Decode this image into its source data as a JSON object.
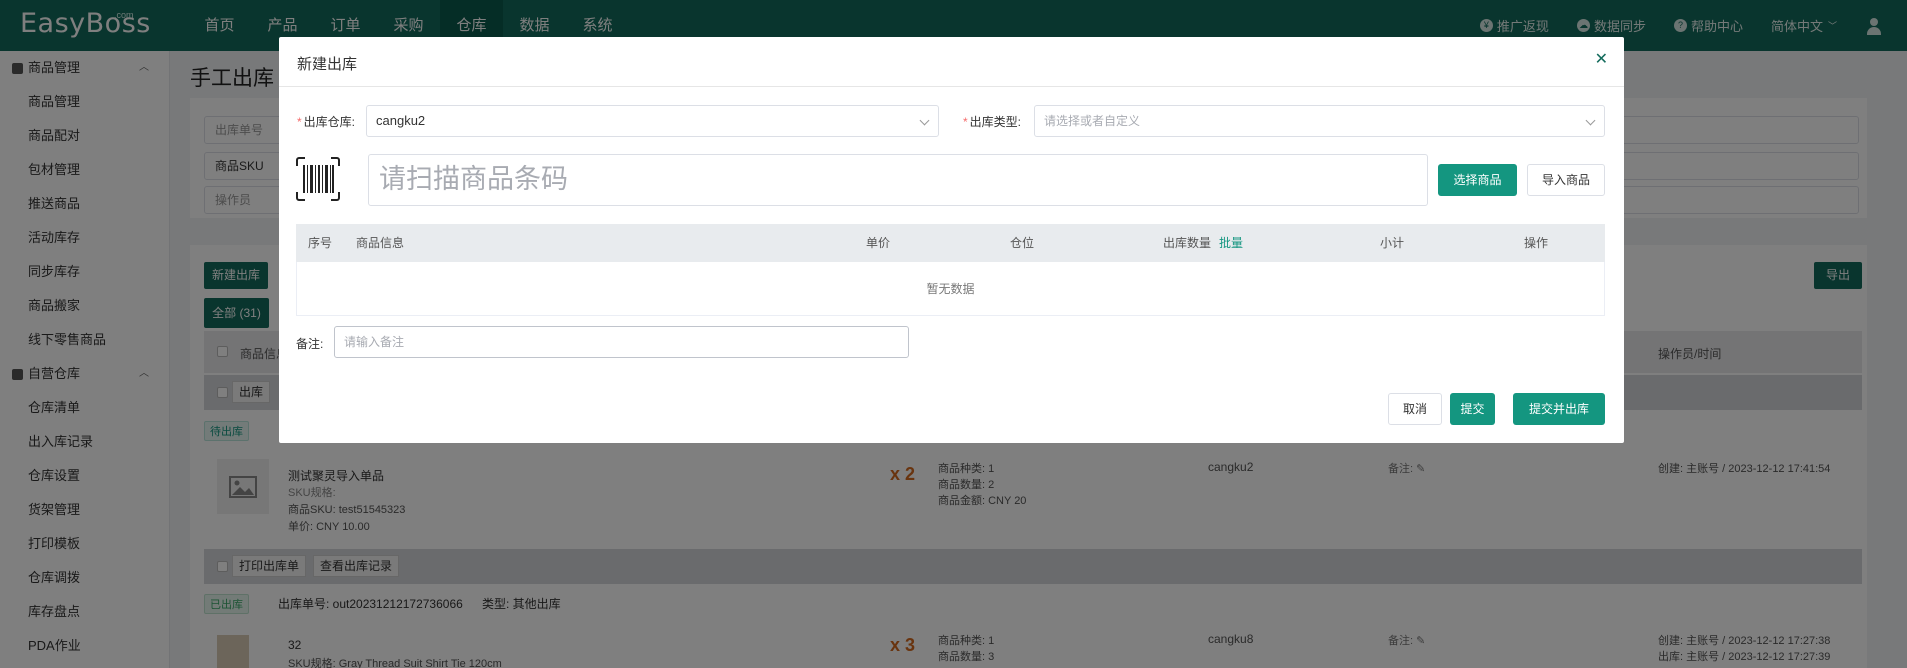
{
  "app": {
    "logo": "EasyBoss",
    "logo_suffix": ".com"
  },
  "nav": [
    "首页",
    "产品",
    "订单",
    "采购",
    "仓库",
    "数据",
    "系统"
  ],
  "top_right": {
    "promo": "推广返现",
    "sync": "数据同步",
    "help": "帮助中心",
    "lang": "简体中文"
  },
  "sidebar": {
    "group1": "商品管理",
    "group1_items": [
      "商品管理",
      "商品配对",
      "包材管理",
      "推送商品",
      "活动库存",
      "同步库存",
      "商品搬家",
      "线下零售商品"
    ],
    "group2": "自营仓库",
    "group2_items": [
      "仓库清单",
      "出入库记录",
      "仓库设置",
      "货架管理",
      "打印模板",
      "仓库调拨",
      "库存盘点",
      "PDA作业"
    ]
  },
  "page": {
    "title": "手工出库",
    "filters": {
      "f1": "出库单号",
      "f2": "商品SKU",
      "f3": "操作员"
    },
    "new_btn": "新建出库",
    "all_tab": "全部 (31)",
    "export_btn": "导出",
    "header_col1": "商品信息",
    "header_col_last": "操作员/时间",
    "row1": {
      "btn": "出库",
      "status": "待出库",
      "name": "测试聚灵导入单品",
      "spec": "SKU规格:",
      "sku": "商品SKU: test51545323",
      "price": "单价: CNY 10.00",
      "qty": "x 2",
      "kinds": "商品种类: 1",
      "count": "商品数量: 2",
      "amount": "商品金额: CNY 20",
      "warehouse": "cangku2",
      "remark": "备注:",
      "created": "创建: 主账号 / 2023-12-12 17:41:54"
    },
    "row2": {
      "btn_print": "打印出库单",
      "btn_record": "查看出库记录",
      "status": "已出库",
      "order_no": "出库单号: out20231212172736066",
      "type": "类型: 其他出库",
      "name": "32",
      "spec": "SKU规格: Gray Thread Suit Shirt Tie 120cm",
      "qty": "x 3",
      "kinds": "商品种类: 1",
      "count": "商品数量: 3",
      "warehouse": "cangku8",
      "remark": "备注:",
      "created": "创建: 主账号 / 2023-12-12 17:27:38",
      "out": "出库: 主账号 / 2023-12-12 17:27:39"
    }
  },
  "modal": {
    "title": "新建出库",
    "warehouse_label": "出库仓库:",
    "warehouse_value": "cangku2",
    "type_label": "出库类型:",
    "type_placeholder": "请选择或者自定义",
    "scan_placeholder": "请扫描商品条码",
    "select_goods": "选择商品",
    "import_goods": "导入商品",
    "columns": [
      "序号",
      "商品信息",
      "单价",
      "仓位",
      "出库数量",
      "小计",
      "操作"
    ],
    "batch_link": "批量",
    "empty": "暂无数据",
    "remark_label": "备注:",
    "remark_placeholder": "请输入备注",
    "cancel": "取消",
    "submit": "提交",
    "submit_out": "提交并出库"
  },
  "colors": {
    "primary": "#136b5c",
    "accent": "#149680",
    "required": "#f56c6c"
  }
}
